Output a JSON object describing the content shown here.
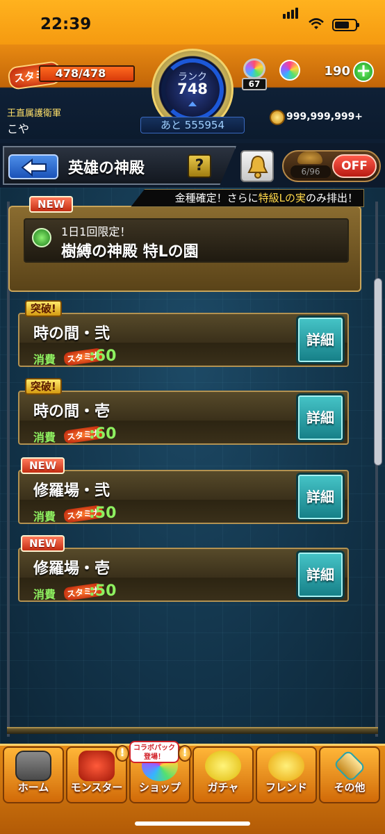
{
  "status_bar": {
    "time": "22:39",
    "signal_icon": "cellular-signal-icon",
    "wifi_icon": "wifi-icon",
    "battery_icon": "battery-icon"
  },
  "header": {
    "stamina_icon_text": "スタミナ",
    "stamina_value": "478/478",
    "rank_label": "ランク",
    "rank_value": "748",
    "next_rank": "あと 555954",
    "gem_count": "67",
    "orb_count": "190",
    "team_name": "王直属護衛軍",
    "player_name": "こや",
    "coins": "999,999,999+"
  },
  "title_bar": {
    "title": "英雄の神殿",
    "help_label": "?",
    "auto_count": "6/96",
    "off_label": "OFF"
  },
  "featured": {
    "banner_prefix": "金種確定！さらに",
    "banner_highlight": "特級Lの実",
    "banner_suffix": "のみ排出！",
    "new_tag": "NEW",
    "subtitle": "1日1回限定！",
    "title": "樹縛の神殿 特Lの園"
  },
  "quests": [
    {
      "tag": "突破!",
      "name": "時の間・弐",
      "cost_label": "消費",
      "stamina_text": "スタミナ",
      "cost": ":60",
      "detail_label": "詳細"
    },
    {
      "tag": "突破!",
      "name": "時の間・壱",
      "cost_label": "消費",
      "stamina_text": "スタミナ",
      "cost": ":60",
      "detail_label": "詳細"
    },
    {
      "tag": "NEW",
      "name": "修羅場・弐",
      "cost_label": "消費",
      "stamina_text": "スタミナ",
      "cost": ":50",
      "detail_label": "詳細"
    },
    {
      "tag": "NEW",
      "name": "修羅場・壱",
      "cost_label": "消費",
      "stamina_text": "スタミナ",
      "cost": ":50",
      "detail_label": "詳細"
    }
  ],
  "tabs": [
    {
      "label": "ホーム",
      "icon": "home-icon"
    },
    {
      "label": "モンスター",
      "icon": "monster-icon"
    },
    {
      "label": "ショップ",
      "icon": "shop-orb-icon"
    },
    {
      "label": "ガチャ",
      "icon": "gacha-egg-icon"
    },
    {
      "label": "フレンド",
      "icon": "friend-balloons-icon"
    },
    {
      "label": "その他",
      "icon": "other-icon"
    }
  ],
  "collab_bubble": {
    "line1": "コラボパック",
    "line2": "登場！"
  },
  "exclaim": "!",
  "colors": {
    "accent_orange": "#f59a10",
    "detail_teal": "#2aa3aa",
    "cost_green": "#8ef060",
    "off_red": "#d8261a"
  }
}
